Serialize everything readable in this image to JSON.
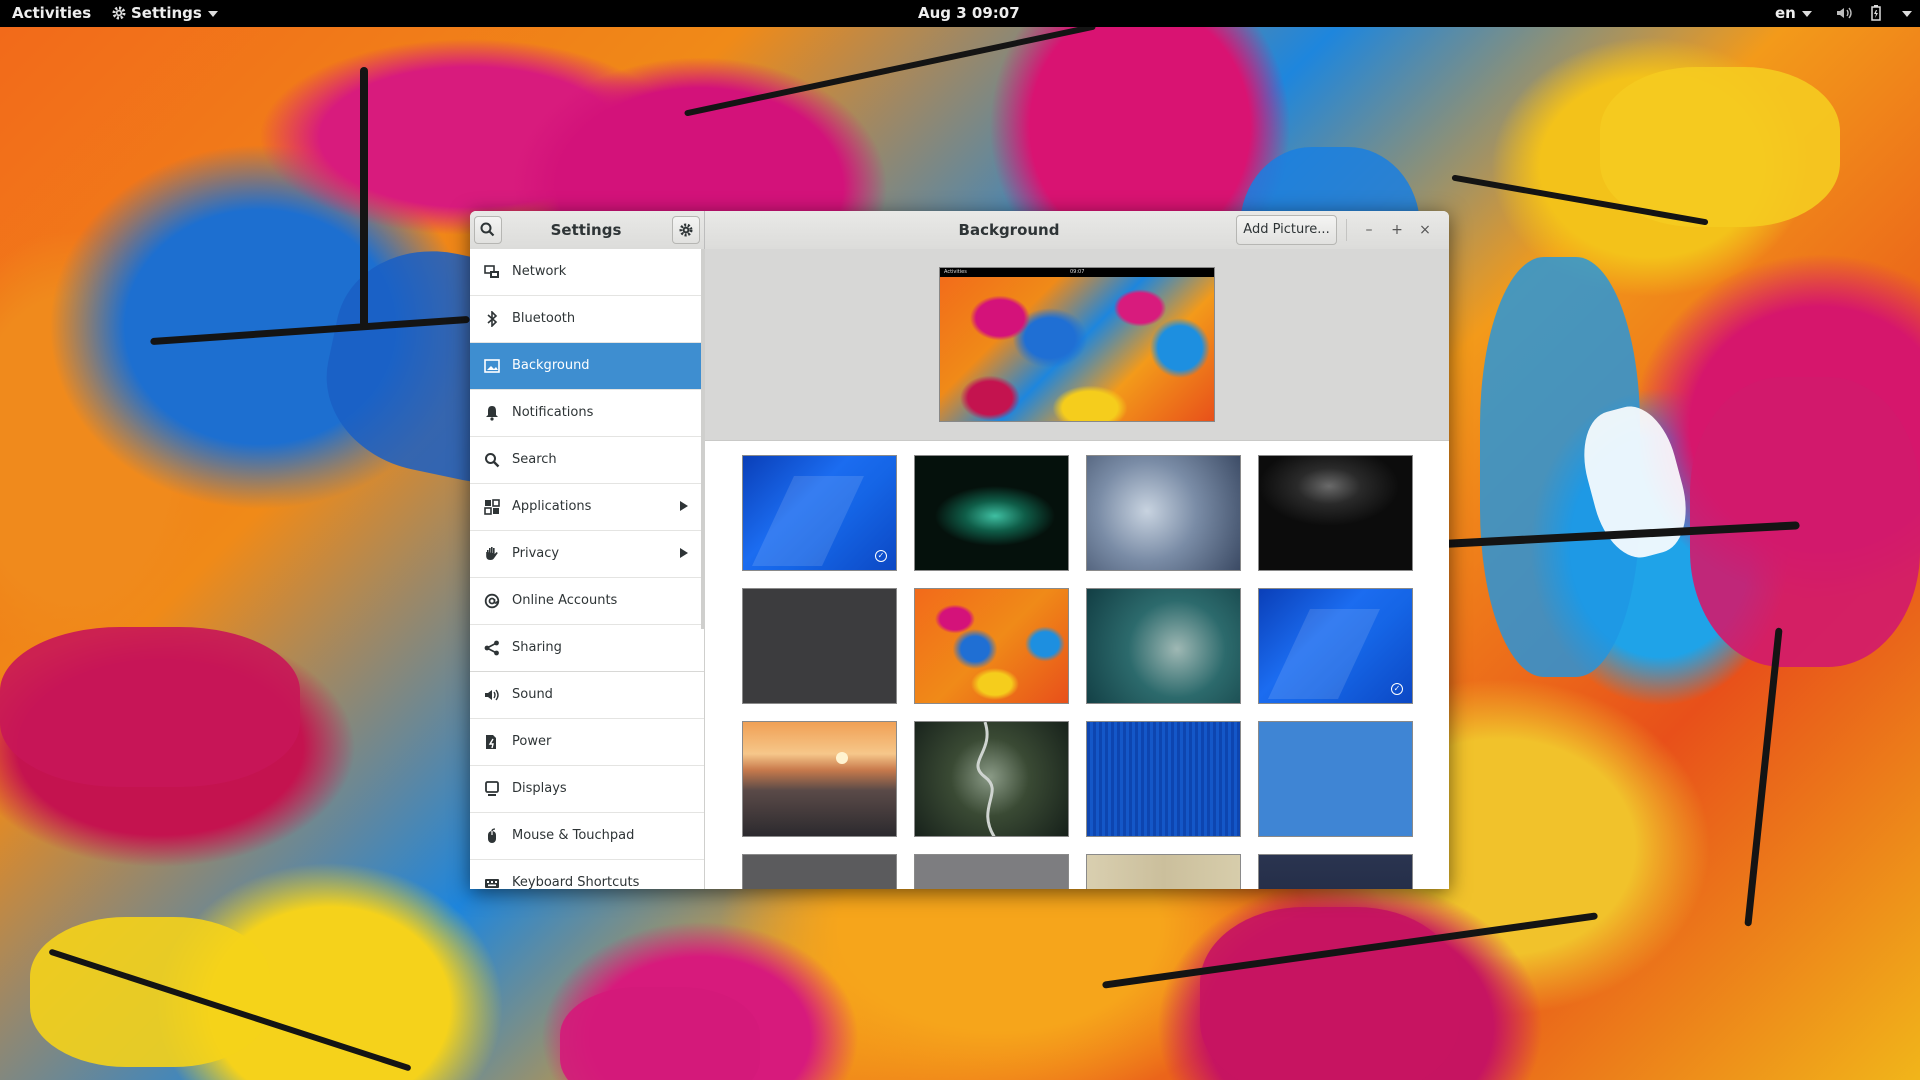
{
  "topbar": {
    "activities": "Activities",
    "app_menu": "Settings",
    "clock": "Aug 3  09:07",
    "input_lang": "en",
    "icons": [
      "volume-icon",
      "battery-icon"
    ]
  },
  "window": {
    "sidebar_title": "Settings",
    "main_title": "Background",
    "add_picture": "Add Picture...",
    "minimize": "–",
    "maximize": "+",
    "close": "×"
  },
  "sidebar": {
    "items": [
      {
        "label": "Network",
        "icon": "network-icon"
      },
      {
        "label": "Bluetooth",
        "icon": "bluetooth-icon"
      },
      {
        "label": "Background",
        "icon": "background-icon",
        "selected": true
      },
      {
        "label": "Notifications",
        "icon": "bell-icon"
      },
      {
        "label": "Search",
        "icon": "search-icon"
      },
      {
        "label": "Applications",
        "icon": "applications-icon",
        "submenu": true
      },
      {
        "label": "Privacy",
        "icon": "hand-icon",
        "submenu": true
      },
      {
        "label": "Online Accounts",
        "icon": "at-icon"
      },
      {
        "label": "Sharing",
        "icon": "share-icon"
      },
      {
        "label": "Sound",
        "icon": "speaker-icon"
      },
      {
        "label": "Power",
        "icon": "power-icon"
      },
      {
        "label": "Displays",
        "icon": "display-icon"
      },
      {
        "label": "Mouse & Touchpad",
        "icon": "mouse-icon"
      },
      {
        "label": "Keyboard Shortcuts",
        "icon": "keyboard-icon"
      }
    ]
  },
  "preview": {
    "bar_left": "Activities",
    "bar_center": "09:07"
  },
  "wallpapers": [
    {
      "name": "blue-geometric",
      "selected": true
    },
    {
      "name": "green-smoke"
    },
    {
      "name": "snowy-forest-aerial"
    },
    {
      "name": "dark-leaves"
    },
    {
      "name": "dark-texture"
    },
    {
      "name": "abstract-paint"
    },
    {
      "name": "teal-trees"
    },
    {
      "name": "blue-geometric-lock",
      "selected": true
    },
    {
      "name": "sunset-sea"
    },
    {
      "name": "winding-road"
    },
    {
      "name": "blue-stripes"
    },
    {
      "name": "light-blue-texture"
    },
    {
      "name": "gray-texture"
    },
    {
      "name": "gray-flat"
    },
    {
      "name": "beige-wood"
    },
    {
      "name": "dark-navy"
    }
  ],
  "colors": {
    "accent": "#3e8ed0",
    "topbar": "#000000"
  }
}
